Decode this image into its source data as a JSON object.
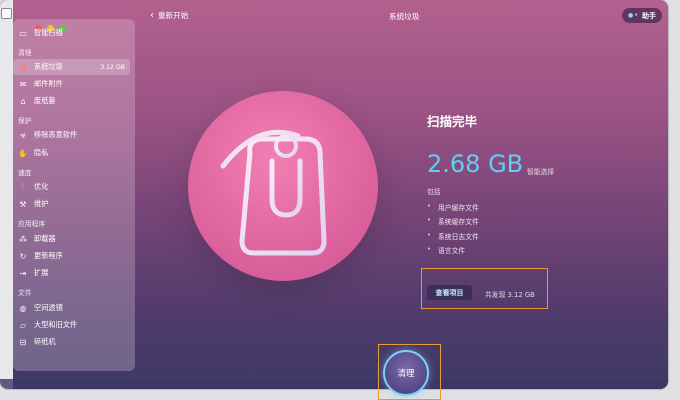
{
  "window": {
    "title": "系统垃圾"
  },
  "topbar": {
    "back_label": "重新开始",
    "assistant_label": "助手"
  },
  "sidebar": {
    "items": [
      {
        "label": "智能扫描",
        "icon": "monitor-icon"
      },
      {
        "section": "清理"
      },
      {
        "label": "系统垃圾",
        "icon": "trash-icon",
        "size": "3.12 GB",
        "active": true
      },
      {
        "label": "邮件附件",
        "icon": "mail-icon"
      },
      {
        "label": "废纸篓",
        "icon": "bin-icon"
      },
      {
        "section": "保护"
      },
      {
        "label": "移除恶意软件",
        "icon": "biohazard-icon"
      },
      {
        "label": "隐私",
        "icon": "hand-icon"
      },
      {
        "section": "速度"
      },
      {
        "label": "优化",
        "icon": "sliders-icon"
      },
      {
        "label": "维护",
        "icon": "wrench-icon"
      },
      {
        "section": "应用程序"
      },
      {
        "label": "卸载器",
        "icon": "uninstall-icon"
      },
      {
        "label": "更新程序",
        "icon": "update-icon"
      },
      {
        "label": "扩展",
        "icon": "extension-icon"
      },
      {
        "section": "文件"
      },
      {
        "label": "空间透镜",
        "icon": "lens-icon"
      },
      {
        "label": "大型和旧文件",
        "icon": "folder-icon"
      },
      {
        "label": "碎纸机",
        "icon": "shredder-icon"
      }
    ]
  },
  "result": {
    "title": "扫描完毕",
    "size": "2.68 GB",
    "smart_select": "智能选择",
    "includes_label": "包括",
    "includes": [
      "用户缓存文件",
      "系统缓存文件",
      "系统日志文件",
      "语言文件"
    ],
    "review_button": "查看项目",
    "found_text": "共发现 3.12 GB"
  },
  "actions": {
    "clean_label": "清理"
  },
  "colors": {
    "accent_blue": "#5ecff5",
    "highlight": "#e79a35",
    "hero_pink": "#e36aa3"
  }
}
